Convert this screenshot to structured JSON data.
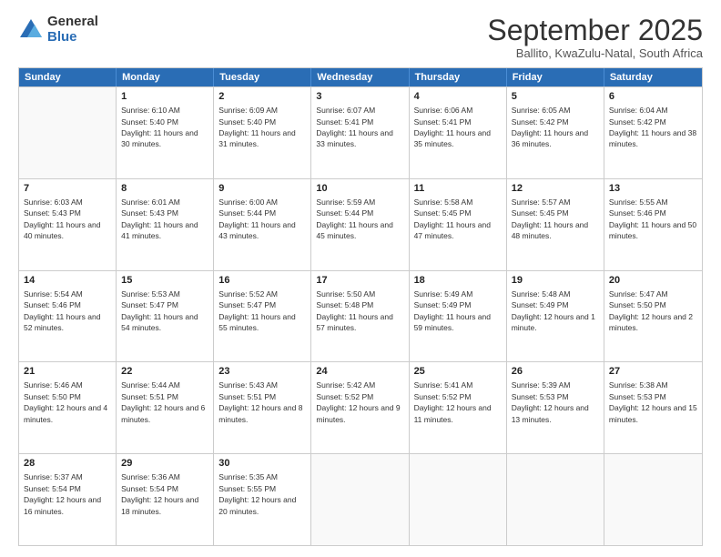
{
  "logo": {
    "general": "General",
    "blue": "Blue"
  },
  "header": {
    "month": "September 2025",
    "location": "Ballito, KwaZulu-Natal, South Africa"
  },
  "days": [
    "Sunday",
    "Monday",
    "Tuesday",
    "Wednesday",
    "Thursday",
    "Friday",
    "Saturday"
  ],
  "rows": [
    [
      {
        "day": "",
        "empty": true
      },
      {
        "day": "1",
        "rise": "6:10 AM",
        "set": "5:40 PM",
        "daylight": "11 hours and 30 minutes."
      },
      {
        "day": "2",
        "rise": "6:09 AM",
        "set": "5:40 PM",
        "daylight": "11 hours and 31 minutes."
      },
      {
        "day": "3",
        "rise": "6:07 AM",
        "set": "5:41 PM",
        "daylight": "11 hours and 33 minutes."
      },
      {
        "day": "4",
        "rise": "6:06 AM",
        "set": "5:41 PM",
        "daylight": "11 hours and 35 minutes."
      },
      {
        "day": "5",
        "rise": "6:05 AM",
        "set": "5:42 PM",
        "daylight": "11 hours and 36 minutes."
      },
      {
        "day": "6",
        "rise": "6:04 AM",
        "set": "5:42 PM",
        "daylight": "11 hours and 38 minutes."
      }
    ],
    [
      {
        "day": "7",
        "rise": "6:03 AM",
        "set": "5:43 PM",
        "daylight": "11 hours and 40 minutes."
      },
      {
        "day": "8",
        "rise": "6:01 AM",
        "set": "5:43 PM",
        "daylight": "11 hours and 41 minutes."
      },
      {
        "day": "9",
        "rise": "6:00 AM",
        "set": "5:44 PM",
        "daylight": "11 hours and 43 minutes."
      },
      {
        "day": "10",
        "rise": "5:59 AM",
        "set": "5:44 PM",
        "daylight": "11 hours and 45 minutes."
      },
      {
        "day": "11",
        "rise": "5:58 AM",
        "set": "5:45 PM",
        "daylight": "11 hours and 47 minutes."
      },
      {
        "day": "12",
        "rise": "5:57 AM",
        "set": "5:45 PM",
        "daylight": "11 hours and 48 minutes."
      },
      {
        "day": "13",
        "rise": "5:55 AM",
        "set": "5:46 PM",
        "daylight": "11 hours and 50 minutes."
      }
    ],
    [
      {
        "day": "14",
        "rise": "5:54 AM",
        "set": "5:46 PM",
        "daylight": "11 hours and 52 minutes."
      },
      {
        "day": "15",
        "rise": "5:53 AM",
        "set": "5:47 PM",
        "daylight": "11 hours and 54 minutes."
      },
      {
        "day": "16",
        "rise": "5:52 AM",
        "set": "5:47 PM",
        "daylight": "11 hours and 55 minutes."
      },
      {
        "day": "17",
        "rise": "5:50 AM",
        "set": "5:48 PM",
        "daylight": "11 hours and 57 minutes."
      },
      {
        "day": "18",
        "rise": "5:49 AM",
        "set": "5:49 PM",
        "daylight": "11 hours and 59 minutes."
      },
      {
        "day": "19",
        "rise": "5:48 AM",
        "set": "5:49 PM",
        "daylight": "12 hours and 1 minute."
      },
      {
        "day": "20",
        "rise": "5:47 AM",
        "set": "5:50 PM",
        "daylight": "12 hours and 2 minutes."
      }
    ],
    [
      {
        "day": "21",
        "rise": "5:46 AM",
        "set": "5:50 PM",
        "daylight": "12 hours and 4 minutes."
      },
      {
        "day": "22",
        "rise": "5:44 AM",
        "set": "5:51 PM",
        "daylight": "12 hours and 6 minutes."
      },
      {
        "day": "23",
        "rise": "5:43 AM",
        "set": "5:51 PM",
        "daylight": "12 hours and 8 minutes."
      },
      {
        "day": "24",
        "rise": "5:42 AM",
        "set": "5:52 PM",
        "daylight": "12 hours and 9 minutes."
      },
      {
        "day": "25",
        "rise": "5:41 AM",
        "set": "5:52 PM",
        "daylight": "12 hours and 11 minutes."
      },
      {
        "day": "26",
        "rise": "5:39 AM",
        "set": "5:53 PM",
        "daylight": "12 hours and 13 minutes."
      },
      {
        "day": "27",
        "rise": "5:38 AM",
        "set": "5:53 PM",
        "daylight": "12 hours and 15 minutes."
      }
    ],
    [
      {
        "day": "28",
        "rise": "5:37 AM",
        "set": "5:54 PM",
        "daylight": "12 hours and 16 minutes."
      },
      {
        "day": "29",
        "rise": "5:36 AM",
        "set": "5:54 PM",
        "daylight": "12 hours and 18 minutes."
      },
      {
        "day": "30",
        "rise": "5:35 AM",
        "set": "5:55 PM",
        "daylight": "12 hours and 20 minutes."
      },
      {
        "day": "",
        "empty": true
      },
      {
        "day": "",
        "empty": true
      },
      {
        "day": "",
        "empty": true
      },
      {
        "day": "",
        "empty": true
      }
    ]
  ]
}
